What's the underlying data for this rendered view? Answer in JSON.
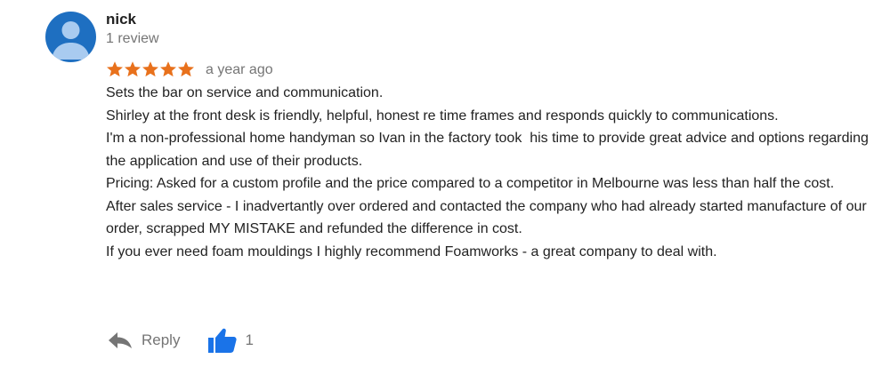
{
  "review": {
    "author": "nick",
    "review_count": "1 review",
    "rating": 5,
    "rating_max": 5,
    "time_ago": "a year ago",
    "lines": [
      "Sets the bar on service and communication.",
      "Shirley at the front desk is friendly, helpful, honest re time frames and responds quickly to communications.",
      "I'm a non-professional home handyman so Ivan in the factory took  his time to provide great advice and options regarding the application and use of their products.",
      "Pricing: Asked for a custom profile and the price compared to a competitor in Melbourne was less than half the cost.",
      "After sales service - I inadvertantly over ordered and contacted the company who had already started manufacture of our order, scrapped MY MISTAKE and refunded the difference in cost.",
      "If you ever need foam mouldings I highly recommend Foamworks - a great company to deal with."
    ]
  },
  "actions": {
    "reply_label": "Reply",
    "like_count": "1"
  },
  "colors": {
    "star": "#e8711c",
    "avatar_bg": "#1e6fc1",
    "avatar_fg": "#a9cbf0",
    "like": "#1a73e8",
    "muted": "#757575"
  },
  "icons": {
    "avatar": "person-avatar-icon",
    "star": "star-icon",
    "reply": "reply-arrow-icon",
    "like": "thumbs-up-icon"
  }
}
